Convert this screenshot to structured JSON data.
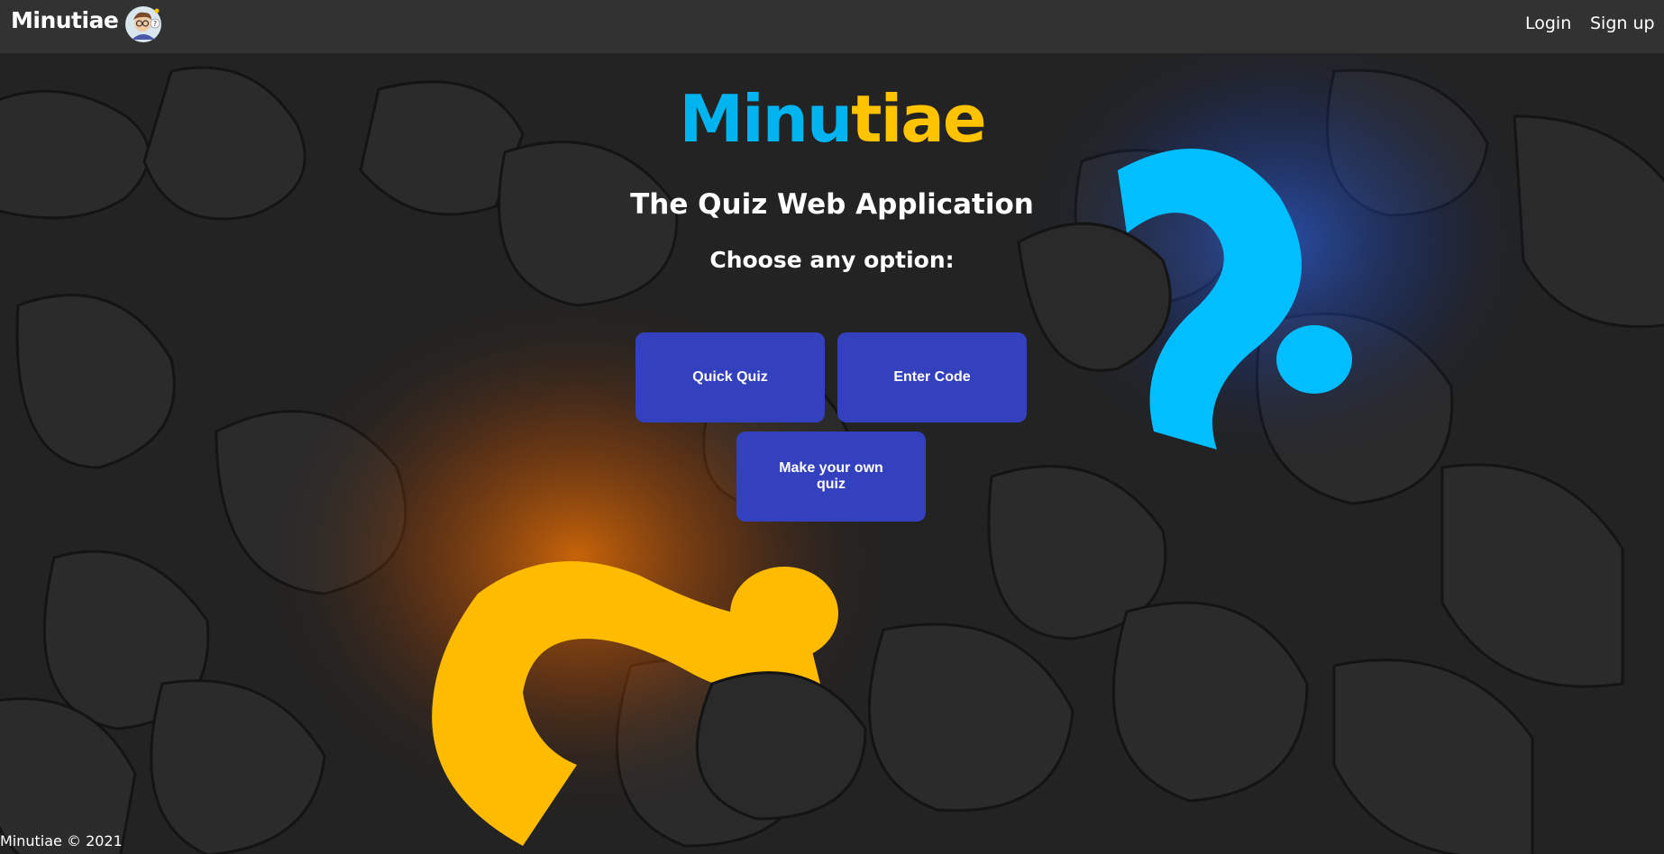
{
  "navbar": {
    "brand": "Minutiae",
    "avatar_icon": "avatar-cartoon-icon",
    "login_label": "Login",
    "signup_label": "Sign up"
  },
  "hero": {
    "logo_part1": "Minu",
    "logo_part2": "tiae",
    "subtitle": "The Quiz Web Application",
    "prompt": "Choose any option:",
    "background": "question-marks-background"
  },
  "buttons": {
    "quick_quiz": "Quick Quiz",
    "enter_code": "Enter Code",
    "make_quiz": "Make your own quiz"
  },
  "footer": {
    "text": "Minutiae © 2021"
  },
  "colors": {
    "navbar": "#323232",
    "logo_blue": "#00b4f0",
    "logo_yellow": "#ffc300",
    "button": "#3441bf"
  }
}
